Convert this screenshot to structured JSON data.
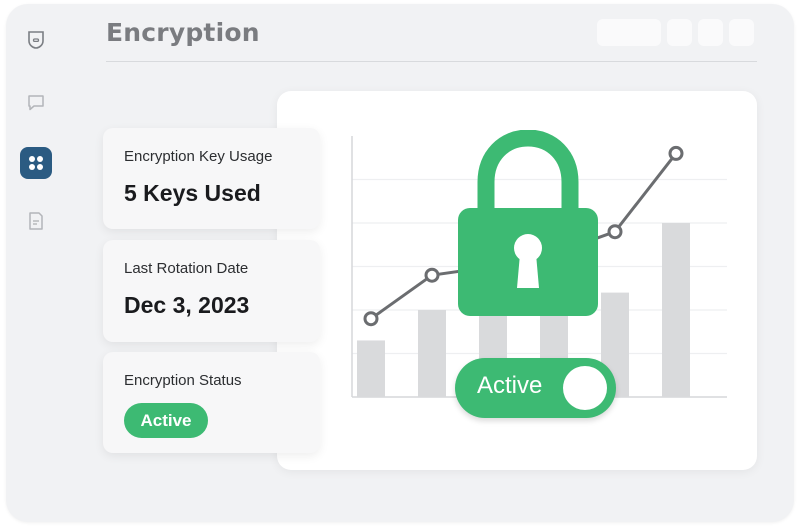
{
  "header": {
    "title": "Encryption"
  },
  "sidebar": {
    "items": [
      {
        "icon": "shield-icon"
      },
      {
        "icon": "chat-bubble-icon"
      },
      {
        "icon": "grid-icon",
        "active": true
      },
      {
        "icon": "document-icon"
      }
    ]
  },
  "cards": {
    "key_usage": {
      "label": "Encryption Key Usage",
      "value": "5 Keys Used"
    },
    "last_rotation": {
      "label": "Last Rotation Date",
      "value": "Dec 3, 2023"
    },
    "status": {
      "label": "Encryption Status",
      "value": "Active"
    }
  },
  "toggle": {
    "label": "Active",
    "on": true
  },
  "colors": {
    "accent_green": "#3dba73",
    "sidebar_active": "#2b5b82",
    "title_gray": "#7a7c80"
  },
  "chart_data": {
    "type": "bar",
    "values": [
      1.3,
      2.0,
      1.9,
      2.6,
      2.4,
      4.0
    ],
    "line_values": [
      1.8,
      2.8,
      3.0,
      3.3,
      3.8,
      5.6
    ],
    "ylim": [
      0,
      6
    ]
  }
}
